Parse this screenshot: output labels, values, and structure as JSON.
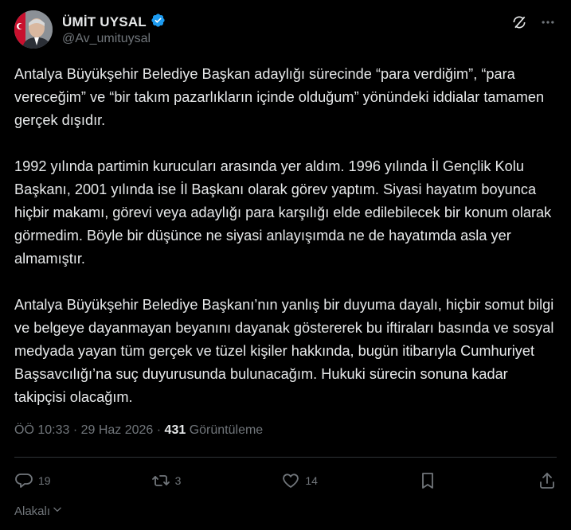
{
  "author": {
    "name": "ÜMİT UYSAL",
    "handle": "@Av_umituysal",
    "verified": true,
    "verified_color": "#1d9bf0"
  },
  "top_icons": [
    "grok-icon",
    "more-icon"
  ],
  "post": {
    "paragraphs": [
      "Antalya Büyükşehir Belediye Başkan adaylığı sürecinde “para verdiğim”, “para vereceğim” ve “bir takım pazarlıkların içinde olduğum” yönündeki iddialar tamamen gerçek dışıdır.",
      "1992 yılında partimin kurucuları arasında yer aldım. 1996 yılında İl Gençlik Kolu Başkanı, 2001 yılında ise İl Başkanı olarak görev yaptım. Siyasi hayatım boyunca hiçbir makamı, görevi veya adaylığı para karşılığı elde edilebilecek bir konum olarak görmedim. Böyle bir düşünce ne siyasi anlayışımda ne de hayatımda asla yer almamıştır.",
      "Antalya Büyükşehir Belediye Başkanı’nın yanlış bir duyuma dayalı, hiçbir somut bilgi ve belgeye dayanmayan beyanını dayanak göstererek bu iftiraları basında ve sosyal medyada yayan tüm gerçek ve tüzel kişiler hakkında, bugün itibarıyla Cumhuriyet Başsavcılığı’na suç duyurusunda bulunacağım. Hukuki sürecin sonuna kadar takipçisi olacağım."
    ]
  },
  "meta": {
    "time": "ÖÖ 10:33",
    "sep": " · ",
    "date": "29 Haz 2026",
    "views_count": "431",
    "views_label": " Görüntüleme"
  },
  "actions": {
    "replies": "19",
    "reposts": "3",
    "likes": "14"
  },
  "related_label": "Alakalı",
  "colors": {
    "background": "#000000",
    "text": "#e7e9ea",
    "muted": "#71767b",
    "divider": "#2f3336"
  }
}
